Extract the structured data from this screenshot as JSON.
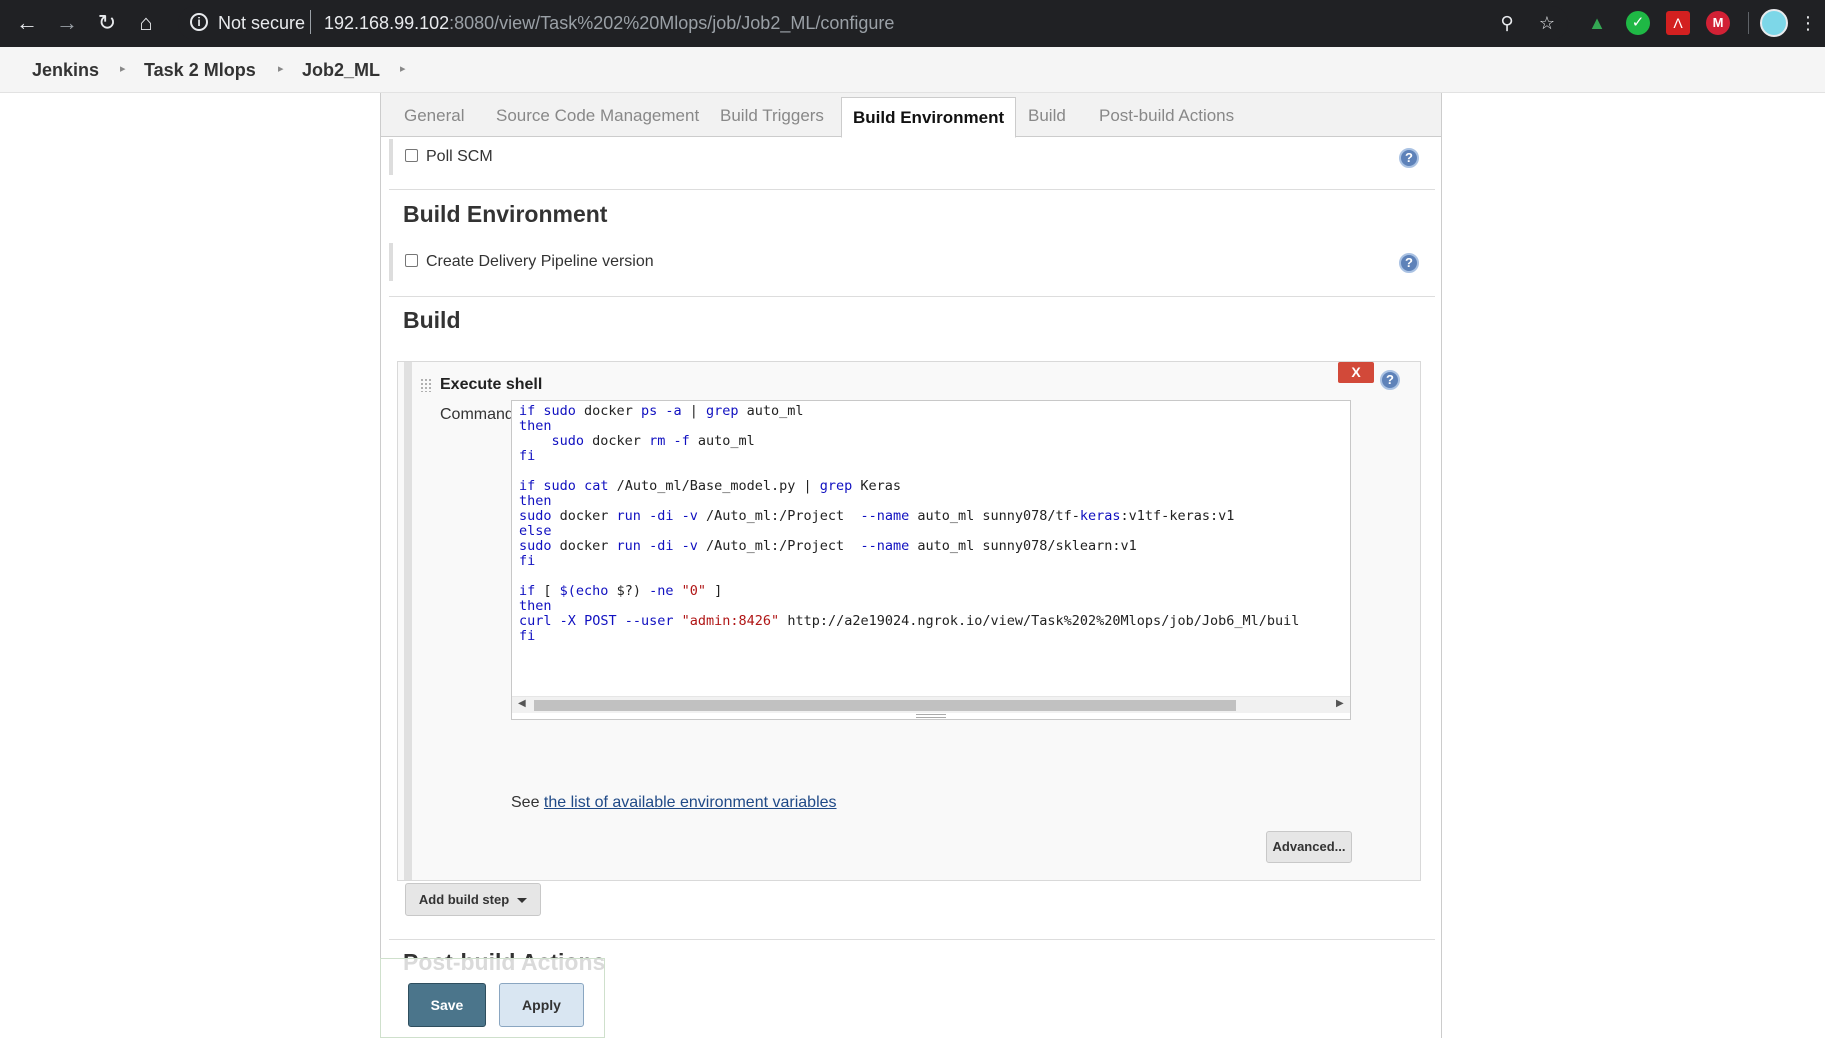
{
  "browser": {
    "security_label": "Not secure",
    "url_host": "192.168.99.102",
    "url_rest": ":8080/view/Task%202%20Mlops/job/Job2_ML/configure"
  },
  "breadcrumb": [
    "Jenkins",
    "Task 2 Mlops",
    "Job2_ML"
  ],
  "tabs": [
    "General",
    "Source Code Management",
    "Build Triggers",
    "Build Environment",
    "Build",
    "Post-build Actions"
  ],
  "active_tab": "Build Environment",
  "triggers": {
    "poll_scm_label": "Poll SCM",
    "poll_scm_checked": false
  },
  "build_environment": {
    "title": "Build Environment",
    "delivery_pipeline_label": "Create Delivery Pipeline version",
    "delivery_pipeline_checked": false
  },
  "build": {
    "title": "Build",
    "step_title": "Execute shell",
    "delete_label": "X",
    "command_label": "Command",
    "command_lines": [
      "if sudo docker ps -a | grep auto_ml",
      "then",
      "    sudo docker rm -f auto_ml",
      "fi",
      "",
      "if sudo cat /Auto_ml/Base_model.py | grep Keras",
      "then",
      "sudo docker run -di -v /Auto_ml:/Project  --name auto_ml sunny078/tf-keras:v1",
      "else",
      "sudo docker run -di -v /Auto_ml:/Project  --name auto_ml sunny078/sklearn:v1",
      "fi",
      "",
      "if [ $(echo $?) -ne \"0\" ]",
      "then",
      "curl -X POST --user \"admin:8426\" http://a2e19024.ngrok.io/view/Task%202%20Mlops/job/Job6_Ml/buil",
      "fi"
    ],
    "see_prefix": "See ",
    "env_vars_link": "the list of available environment variables",
    "advanced_label": "Advanced...",
    "add_step_label": "Add build step"
  },
  "post_build": {
    "title": "Post-build Actions"
  },
  "actions": {
    "save_label": "Save",
    "apply_label": "Apply"
  }
}
